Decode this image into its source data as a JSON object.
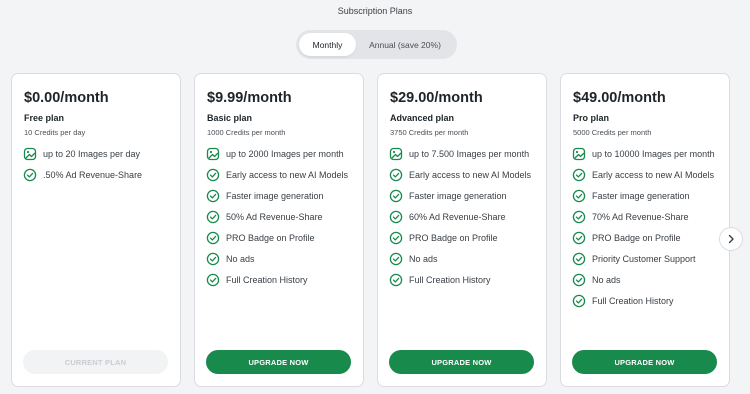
{
  "header": {
    "title": "Subscription Plans"
  },
  "billing_toggle": {
    "monthly_label": "Monthly",
    "annual_label": "Annual (save 20%)",
    "selected": "Monthly"
  },
  "plans": [
    {
      "price": "$0.00/month",
      "name": "Free plan",
      "credits": "10 Credits per day",
      "features": [
        {
          "icon": "image-icon",
          "text": "up to 20 Images per day"
        },
        {
          "icon": "check-circle-icon",
          "text": ".50% Ad Revenue-Share"
        }
      ],
      "cta": "CURRENT PLAN"
    },
    {
      "price": "$9.99/month",
      "name": "Basic plan",
      "credits": "1000 Credits per month",
      "features": [
        {
          "icon": "image-icon",
          "text": "up to 2000 Images per month"
        },
        {
          "icon": "check-circle-icon",
          "text": "Early access to new AI Models"
        },
        {
          "icon": "check-circle-icon",
          "text": "Faster image generation"
        },
        {
          "icon": "check-circle-icon",
          "text": "50% Ad Revenue-Share"
        },
        {
          "icon": "check-circle-icon",
          "text": "PRO Badge on Profile"
        },
        {
          "icon": "check-circle-icon",
          "text": "No ads"
        },
        {
          "icon": "check-circle-icon",
          "text": "Full Creation History"
        }
      ],
      "cta": "UPGRADE NOW"
    },
    {
      "price": "$29.00/month",
      "name": "Advanced plan",
      "credits": "3750 Credits per month",
      "features": [
        {
          "icon": "image-icon",
          "text": "up to 7.500 Images per month"
        },
        {
          "icon": "check-circle-icon",
          "text": "Early access to new AI Models"
        },
        {
          "icon": "check-circle-icon",
          "text": "Faster image generation"
        },
        {
          "icon": "check-circle-icon",
          "text": "60% Ad Revenue-Share"
        },
        {
          "icon": "check-circle-icon",
          "text": "PRO Badge on Profile"
        },
        {
          "icon": "check-circle-icon",
          "text": "No ads"
        },
        {
          "icon": "check-circle-icon",
          "text": "Full Creation History"
        }
      ],
      "cta": "UPGRADE NOW"
    },
    {
      "price": "$49.00/month",
      "name": "Pro plan",
      "credits": "5000 Credits per month",
      "features": [
        {
          "icon": "image-icon",
          "text": "up to 10000 Images per month"
        },
        {
          "icon": "check-circle-icon",
          "text": "Early access to new AI Models"
        },
        {
          "icon": "check-circle-icon",
          "text": "Faster image generation"
        },
        {
          "icon": "check-circle-icon",
          "text": "70% Ad Revenue-Share"
        },
        {
          "icon": "check-circle-icon",
          "text": "PRO Badge on Profile"
        },
        {
          "icon": "check-circle-icon",
          "text": "Priority Customer Support"
        },
        {
          "icon": "check-circle-icon",
          "text": "No ads"
        },
        {
          "icon": "check-circle-icon",
          "text": "Full Creation History"
        }
      ],
      "cta": "UPGRADE NOW"
    }
  ],
  "carousel": {
    "next_icon": "chevron-right-icon"
  },
  "colors": {
    "accent": "#178a4c",
    "background": "#f3f4f5",
    "card": "#ffffff",
    "disabled": "#f1f3f4"
  }
}
